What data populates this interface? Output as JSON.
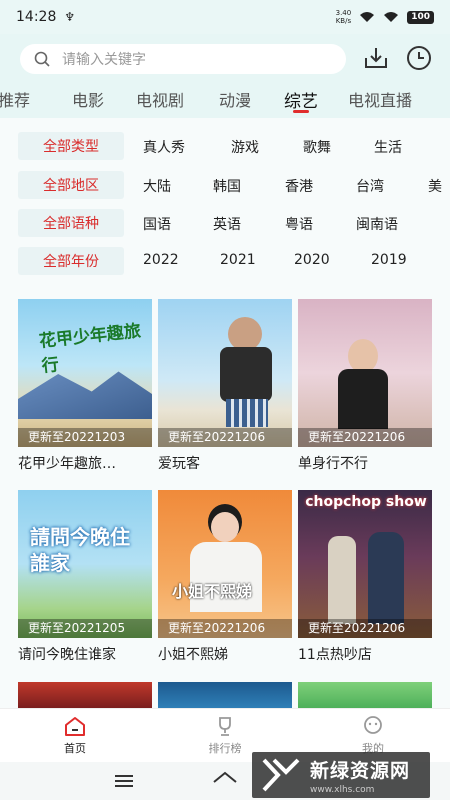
{
  "status": {
    "time": "14:28",
    "usb": "♆",
    "net_speed_value": "3.40",
    "net_speed_unit": "KB/s",
    "battery": "100"
  },
  "search": {
    "placeholder": "请输入关键字"
  },
  "icons": {
    "download": "download-icon",
    "history": "clock-icon",
    "search": "search-icon"
  },
  "tabs": [
    {
      "label": "推荐"
    },
    {
      "label": "电影"
    },
    {
      "label": "电视剧"
    },
    {
      "label": "动漫"
    },
    {
      "label": "综艺",
      "active": true
    },
    {
      "label": "电视直播"
    }
  ],
  "filters": [
    {
      "chip": "全部类型",
      "options": [
        "真人秀",
        "游戏",
        "歌舞",
        "生活"
      ]
    },
    {
      "chip": "全部地区",
      "options": [
        "大陆",
        "韩国",
        "香港",
        "台湾",
        "美"
      ]
    },
    {
      "chip": "全部语种",
      "options": [
        "国语",
        "英语",
        "粤语",
        "闽南语"
      ]
    },
    {
      "chip": "全部年份",
      "options": [
        "2022",
        "2021",
        "2020",
        "2019"
      ]
    }
  ],
  "cards": [
    {
      "title": "花甲少年趣旅…",
      "update": "更新至20221203",
      "poster_text": "花甲少年趣旅行"
    },
    {
      "title": "爱玩客",
      "update": "更新至20221206",
      "poster_text": ""
    },
    {
      "title": "单身行不行",
      "update": "更新至20221206",
      "poster_text": ""
    },
    {
      "title": "请问今晚住谁家",
      "update": "更新至20221205",
      "poster_text": "請問今晚住誰家"
    },
    {
      "title": "小姐不熙娣",
      "update": "更新至20221206",
      "poster_text": "小姐不熙娣"
    },
    {
      "title": "11点热吵店",
      "update": "更新至20221206",
      "poster_text": "chopchop show"
    }
  ],
  "nav": [
    {
      "label": "首页",
      "active": true
    },
    {
      "label": "排行榜"
    },
    {
      "label": "我的"
    }
  ],
  "watermark": {
    "title": "新绿资源网",
    "url": "www.xlhs.com"
  },
  "colors": {
    "accent": "#e02d2d",
    "header_bg": "#e7f6f5",
    "chip_bg": "#e9f3f4"
  }
}
